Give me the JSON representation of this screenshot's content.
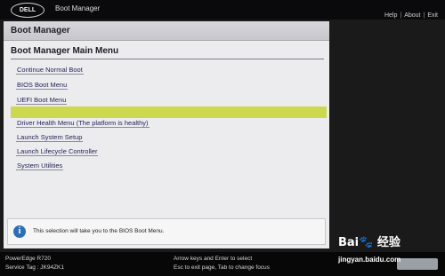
{
  "topbar": {
    "brand": "DELL",
    "app_title": "Boot Manager",
    "links": [
      "Help",
      "About",
      "Exit"
    ]
  },
  "panel": {
    "header": "Boot Manager",
    "section_title": "Boot Manager Main Menu",
    "menu_items": [
      "Continue Normal Boot",
      "BIOS Boot Menu",
      "UEFI Boot Menu",
      "Driver Health Menu (The platform is healthy)",
      "Launch System Setup",
      "Launch Lifecycle Controller",
      "System Utilities"
    ],
    "selected_item": "BIOS Boot Menu",
    "help_text": "This selection will take you to the BIOS Boot Menu."
  },
  "footer": {
    "model": "PowerEdge R720",
    "service_tag": "Service Tag : JK94ZK1",
    "hint_line1": "Arrow keys and Enter to select",
    "hint_line2": "Esc to exit page, Tab to change focus"
  },
  "watermark": {
    "logo": "Bai🐾 经验",
    "url": "jingyan.baidu.com"
  },
  "colors": {
    "highlight": "#ccd84e",
    "panel_bg": "#ececef",
    "info_icon": "#2e6fb3"
  }
}
